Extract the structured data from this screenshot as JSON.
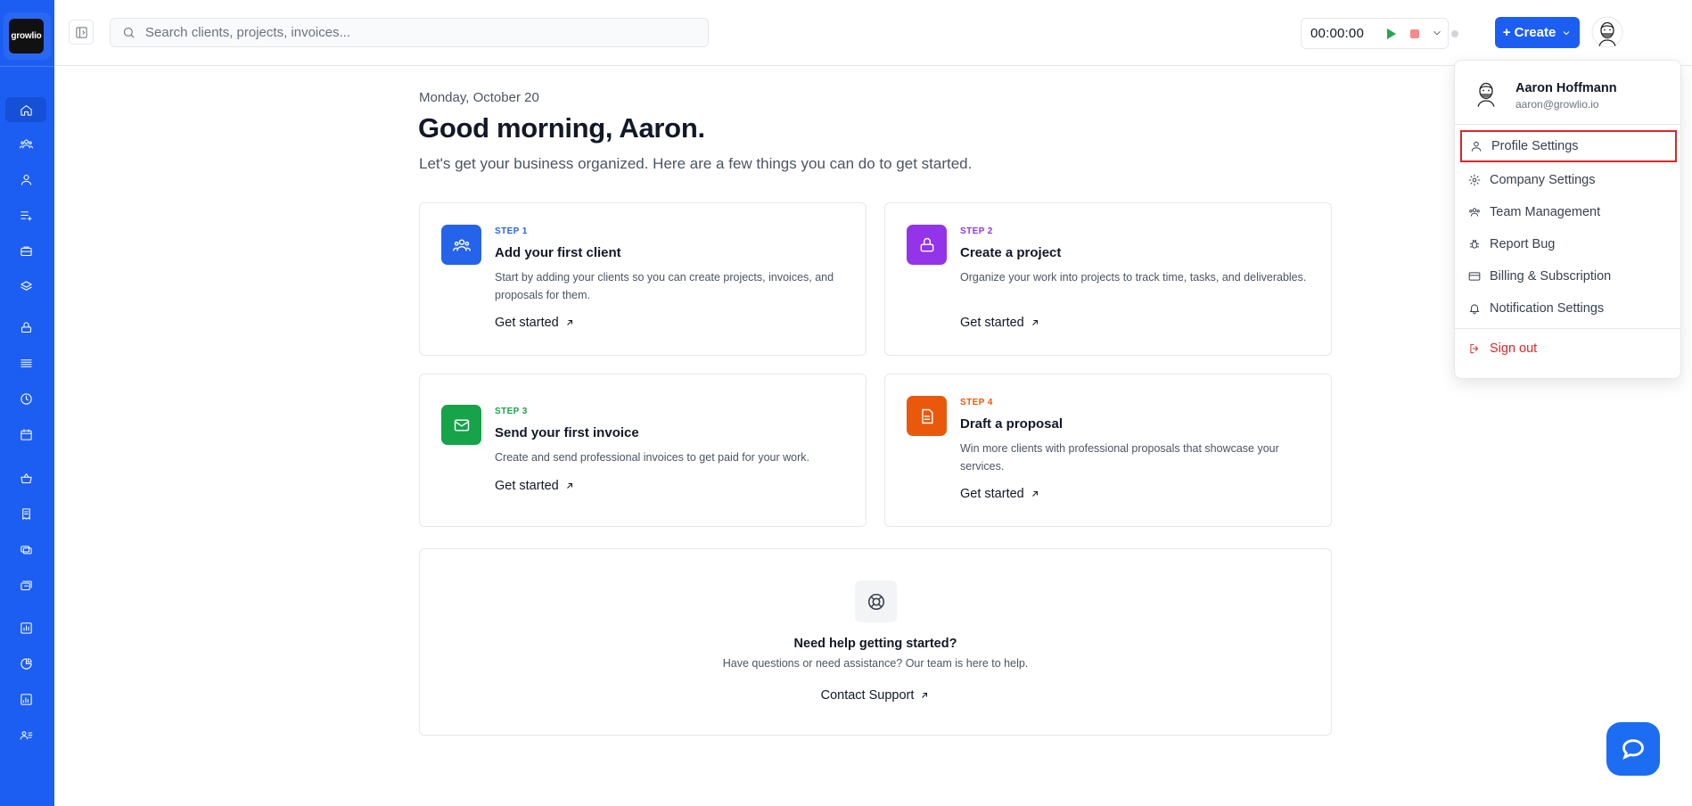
{
  "brand": {
    "logo_text": "growlio",
    "primary": "#1d5ef2"
  },
  "sidebar": {
    "items": [
      {
        "name": "home-icon",
        "active": true
      },
      {
        "name": "clients-icon"
      },
      {
        "name": "user-icon"
      },
      {
        "name": "list-add-icon"
      },
      {
        "name": "briefcase-icon"
      },
      {
        "name": "layers-icon"
      },
      {
        "name": "lock-box-icon"
      },
      {
        "name": "menu-lines-icon"
      },
      {
        "name": "clock-icon"
      },
      {
        "name": "calendar-icon"
      },
      {
        "name": "basket-icon"
      },
      {
        "name": "receipt-icon"
      },
      {
        "name": "coins-icon"
      },
      {
        "name": "stack-cards-icon"
      },
      {
        "name": "chart-box-icon"
      },
      {
        "name": "pie-chart-icon"
      },
      {
        "name": "bar-chart-icon"
      },
      {
        "name": "user-list-icon"
      }
    ]
  },
  "topbar": {
    "search_placeholder": "Search clients, projects, invoices...",
    "timer": "00:00:00",
    "create_label": "+ Create"
  },
  "main": {
    "date": "Monday, October 20",
    "greeting": "Good morning, Aaron.",
    "subtitle": "Let's get your business organized. Here are a few things you can do to get started.",
    "steps": [
      {
        "step": "STEP 1",
        "title": "Add your first client",
        "desc": "Start by adding your clients so you can create projects, invoices, and proposals for them.",
        "cta": "Get started",
        "color": "#2563eb"
      },
      {
        "step": "STEP 2",
        "title": "Create a project",
        "desc": "Organize your work into projects to track time, tasks, and deliverables.",
        "cta": "Get started",
        "color": "#9333ea"
      },
      {
        "step": "STEP 3",
        "title": "Send your first invoice",
        "desc": "Create and send professional invoices to get paid for your work.",
        "cta": "Get started",
        "color": "#16a34a"
      },
      {
        "step": "STEP 4",
        "title": "Draft a proposal",
        "desc": "Win more clients with professional proposals that showcase your services.",
        "cta": "Get started",
        "color": "#ea580c"
      }
    ],
    "help": {
      "title": "Need help getting started?",
      "desc": "Have questions or need assistance? Our team is here to help.",
      "cta": "Contact Support"
    }
  },
  "user_menu": {
    "name": "Aaron Hoffmann",
    "email": "aaron@growlio.io",
    "items": [
      {
        "label": "Profile Settings",
        "icon": "user-icon"
      },
      {
        "label": "Company Settings",
        "icon": "gear-icon"
      },
      {
        "label": "Team Management",
        "icon": "team-icon"
      },
      {
        "label": "Report Bug",
        "icon": "bug-icon"
      },
      {
        "label": "Billing & Subscription",
        "icon": "credit-card-icon"
      },
      {
        "label": "Notification Settings",
        "icon": "bell-icon"
      }
    ],
    "sign_out": "Sign out"
  }
}
